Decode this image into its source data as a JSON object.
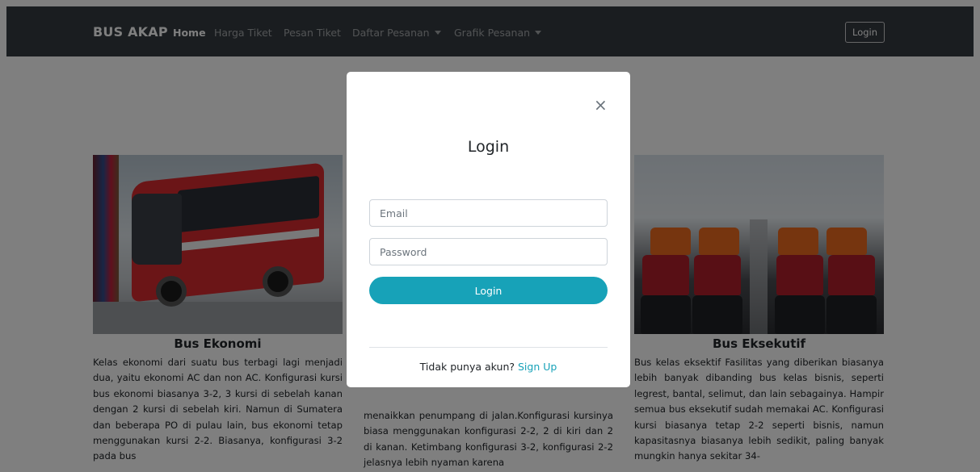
{
  "navbar": {
    "brand": "BUS AKAP",
    "links": [
      {
        "label": "Home"
      },
      {
        "label": "Harga Tiket"
      },
      {
        "label": "Pesan Tiket"
      },
      {
        "label": "Daftar Pesanan"
      },
      {
        "label": "Grafik Pesanan"
      }
    ],
    "login_label": "Login"
  },
  "cards": [
    {
      "title": "Bus Ekonomi",
      "text": "Kelas ekonomi dari suatu bus terbagi lagi menjadi dua, yaitu ekonomi AC dan non AC. Konfigurasi kursi bus ekonomi biasanya 3-2, 3 kursi di sebelah kanan dengan 2 kursi di sebelah kiri. Namun di Sumatera dan beberapa PO di pulau lain, bus ekonomi tetap menggunakan kursi 2-2. Biasanya, konfigurasi 3-2 pada bus"
    },
    {
      "title": "",
      "text": "menaikkan penumpang di jalan.Konfigurasi kursinya biasa menggunakan konfigurasi 2-2, 2 di kiri dan 2 di kanan. Ketimbang konfigurasi 3-2, konfigurasi 2-2 jelasnya lebih nyaman karena"
    },
    {
      "title": "Bus Eksekutif",
      "text": "Bus kelas eksektif Fasilitas yang diberikan biasanya lebih banyak dibanding bus kelas bisnis, seperti legrest, bantal, selimut, dan lain sebagainya. Hampir semua bus eksekutif sudah memakai AC. Konfigurasi kursi biasanya tetap 2-2 seperti bisnis, namun kapasitasnya biasanya lebih sedikit, paling banyak mungkin hanya sekitar 34-"
    }
  ],
  "modal": {
    "close": "×",
    "title": "Login",
    "email_placeholder": "Email",
    "password_placeholder": "Password",
    "login_button": "Login",
    "signup_prompt": "Tidak punya akun?",
    "signup_link": "Sign Up"
  },
  "colors": {
    "navbar_bg": "#343a40",
    "accent": "#17a2b8",
    "overlay": "rgba(0,0,0,0.5)"
  }
}
